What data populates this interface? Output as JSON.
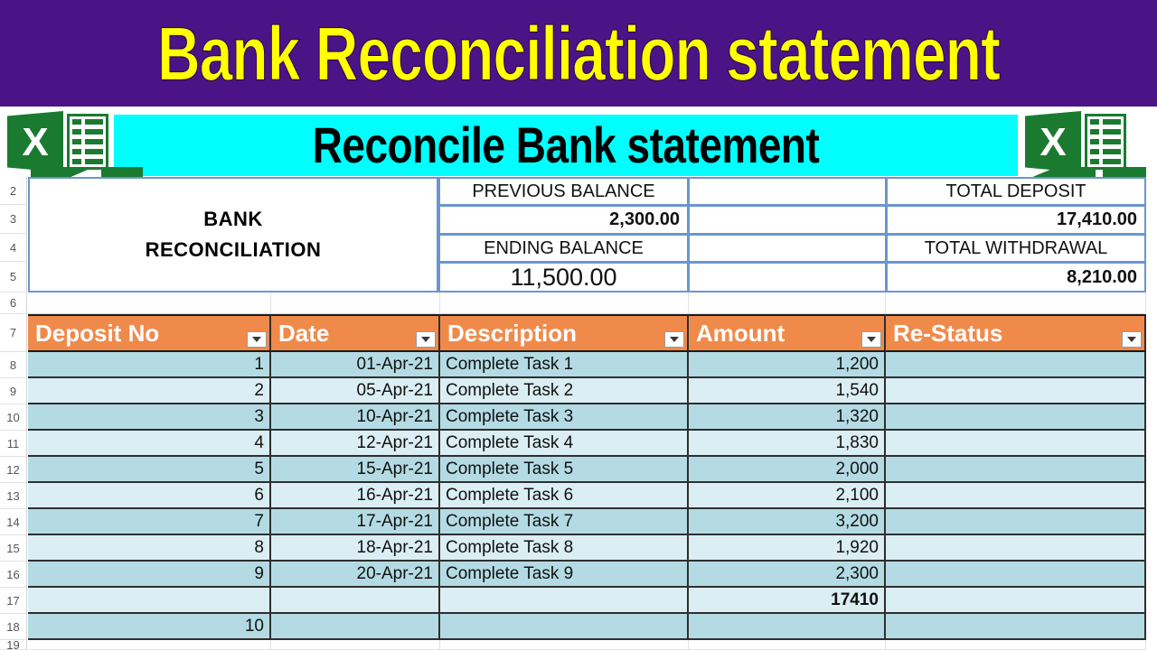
{
  "banner": {
    "title": "Bank Reconciliation statement",
    "subtitle": "Reconcile Bank statement",
    "title_bg": "#4B1486",
    "title_color": "#FFFF00",
    "subtitle_bg": "#00FFFF",
    "subtitle_color": "#000000",
    "excel_icon_color": "#1A7B30",
    "icon_left": "excel-logo-icon",
    "icon_right": "excel-logo-icon"
  },
  "sheet": {
    "row_headers": [
      "2",
      "3",
      "4",
      "5",
      "6",
      "7",
      "8",
      "9",
      "10",
      "11",
      "12",
      "13",
      "14",
      "15",
      "16",
      "17",
      "18",
      "19"
    ],
    "merged_title_line1": "BANK",
    "merged_title_line2": "RECONCILIATION",
    "summary": [
      {
        "label": "PREVIOUS BALANCE",
        "value": "2,300.00",
        "label2": "TOTAL DEPOSIT",
        "value2": "17,410.00"
      },
      {
        "label": "ENDING BALANCE",
        "value": "11,500.00",
        "label2": "TOTAL WITHDRAWAL",
        "value2": "8,210.00"
      }
    ],
    "summary_cells": {
      "previous_balance_label": "PREVIOUS BALANCE",
      "previous_balance_value": "2,300.00",
      "ending_balance_label": "ENDING BALANCE",
      "ending_balance_value": "11,500.00",
      "total_deposit_label": "TOTAL DEPOSIT",
      "total_deposit_value": "17,410.00",
      "total_withdrawal_label": "TOTAL WITHDRAWAL",
      "total_withdrawal_value": "8,210.00"
    },
    "table": {
      "header_bg": "#F08A4B",
      "header_color": "#FFFFFF",
      "band_dark": "#B4DBE3",
      "band_light": "#DAEEF3",
      "columns": [
        "Deposit No",
        "Date",
        "Description",
        "Amount",
        "Re-Status"
      ],
      "rows": [
        {
          "no": "1",
          "date": "01-Apr-21",
          "desc": "Complete Task 1",
          "amount": "1,200",
          "status": ""
        },
        {
          "no": "2",
          "date": "05-Apr-21",
          "desc": "Complete Task 2",
          "amount": "1,540",
          "status": ""
        },
        {
          "no": "3",
          "date": "10-Apr-21",
          "desc": "Complete Task 3",
          "amount": "1,320",
          "status": ""
        },
        {
          "no": "4",
          "date": "12-Apr-21",
          "desc": "Complete Task 4",
          "amount": "1,830",
          "status": ""
        },
        {
          "no": "5",
          "date": "15-Apr-21",
          "desc": "Complete Task 5",
          "amount": "2,000",
          "status": ""
        },
        {
          "no": "6",
          "date": "16-Apr-21",
          "desc": "Complete Task 6",
          "amount": "2,100",
          "status": ""
        },
        {
          "no": "7",
          "date": "17-Apr-21",
          "desc": "Complete Task 7",
          "amount": "3,200",
          "status": ""
        },
        {
          "no": "8",
          "date": "18-Apr-21",
          "desc": "Complete Task 8",
          "amount": "1,920",
          "status": ""
        },
        {
          "no": "9",
          "date": "20-Apr-21",
          "desc": "Complete Task 9",
          "amount": "2,300",
          "status": ""
        },
        {
          "no": "",
          "date": "",
          "desc": "",
          "amount": "17410",
          "status": "",
          "bold_amount": true
        },
        {
          "no": "10",
          "date": "",
          "desc": "",
          "amount": "",
          "status": ""
        }
      ]
    }
  }
}
